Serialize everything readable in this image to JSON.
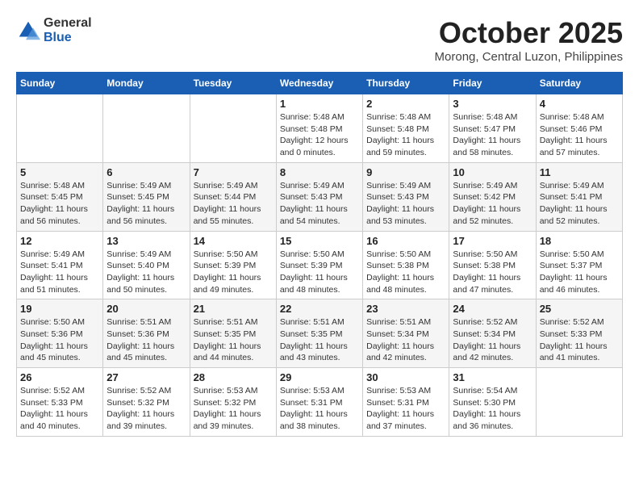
{
  "header": {
    "logo_general": "General",
    "logo_blue": "Blue",
    "month_title": "October 2025",
    "location": "Morong, Central Luzon, Philippines"
  },
  "days_of_week": [
    "Sunday",
    "Monday",
    "Tuesday",
    "Wednesday",
    "Thursday",
    "Friday",
    "Saturday"
  ],
  "weeks": [
    [
      {
        "day": "",
        "info": ""
      },
      {
        "day": "",
        "info": ""
      },
      {
        "day": "",
        "info": ""
      },
      {
        "day": "1",
        "info": "Sunrise: 5:48 AM\nSunset: 5:48 PM\nDaylight: 12 hours and 0 minutes."
      },
      {
        "day": "2",
        "info": "Sunrise: 5:48 AM\nSunset: 5:48 PM\nDaylight: 11 hours and 59 minutes."
      },
      {
        "day": "3",
        "info": "Sunrise: 5:48 AM\nSunset: 5:47 PM\nDaylight: 11 hours and 58 minutes."
      },
      {
        "day": "4",
        "info": "Sunrise: 5:48 AM\nSunset: 5:46 PM\nDaylight: 11 hours and 57 minutes."
      }
    ],
    [
      {
        "day": "5",
        "info": "Sunrise: 5:48 AM\nSunset: 5:45 PM\nDaylight: 11 hours and 56 minutes."
      },
      {
        "day": "6",
        "info": "Sunrise: 5:49 AM\nSunset: 5:45 PM\nDaylight: 11 hours and 56 minutes."
      },
      {
        "day": "7",
        "info": "Sunrise: 5:49 AM\nSunset: 5:44 PM\nDaylight: 11 hours and 55 minutes."
      },
      {
        "day": "8",
        "info": "Sunrise: 5:49 AM\nSunset: 5:43 PM\nDaylight: 11 hours and 54 minutes."
      },
      {
        "day": "9",
        "info": "Sunrise: 5:49 AM\nSunset: 5:43 PM\nDaylight: 11 hours and 53 minutes."
      },
      {
        "day": "10",
        "info": "Sunrise: 5:49 AM\nSunset: 5:42 PM\nDaylight: 11 hours and 52 minutes."
      },
      {
        "day": "11",
        "info": "Sunrise: 5:49 AM\nSunset: 5:41 PM\nDaylight: 11 hours and 52 minutes."
      }
    ],
    [
      {
        "day": "12",
        "info": "Sunrise: 5:49 AM\nSunset: 5:41 PM\nDaylight: 11 hours and 51 minutes."
      },
      {
        "day": "13",
        "info": "Sunrise: 5:49 AM\nSunset: 5:40 PM\nDaylight: 11 hours and 50 minutes."
      },
      {
        "day": "14",
        "info": "Sunrise: 5:50 AM\nSunset: 5:39 PM\nDaylight: 11 hours and 49 minutes."
      },
      {
        "day": "15",
        "info": "Sunrise: 5:50 AM\nSunset: 5:39 PM\nDaylight: 11 hours and 48 minutes."
      },
      {
        "day": "16",
        "info": "Sunrise: 5:50 AM\nSunset: 5:38 PM\nDaylight: 11 hours and 48 minutes."
      },
      {
        "day": "17",
        "info": "Sunrise: 5:50 AM\nSunset: 5:38 PM\nDaylight: 11 hours and 47 minutes."
      },
      {
        "day": "18",
        "info": "Sunrise: 5:50 AM\nSunset: 5:37 PM\nDaylight: 11 hours and 46 minutes."
      }
    ],
    [
      {
        "day": "19",
        "info": "Sunrise: 5:50 AM\nSunset: 5:36 PM\nDaylight: 11 hours and 45 minutes."
      },
      {
        "day": "20",
        "info": "Sunrise: 5:51 AM\nSunset: 5:36 PM\nDaylight: 11 hours and 45 minutes."
      },
      {
        "day": "21",
        "info": "Sunrise: 5:51 AM\nSunset: 5:35 PM\nDaylight: 11 hours and 44 minutes."
      },
      {
        "day": "22",
        "info": "Sunrise: 5:51 AM\nSunset: 5:35 PM\nDaylight: 11 hours and 43 minutes."
      },
      {
        "day": "23",
        "info": "Sunrise: 5:51 AM\nSunset: 5:34 PM\nDaylight: 11 hours and 42 minutes."
      },
      {
        "day": "24",
        "info": "Sunrise: 5:52 AM\nSunset: 5:34 PM\nDaylight: 11 hours and 42 minutes."
      },
      {
        "day": "25",
        "info": "Sunrise: 5:52 AM\nSunset: 5:33 PM\nDaylight: 11 hours and 41 minutes."
      }
    ],
    [
      {
        "day": "26",
        "info": "Sunrise: 5:52 AM\nSunset: 5:33 PM\nDaylight: 11 hours and 40 minutes."
      },
      {
        "day": "27",
        "info": "Sunrise: 5:52 AM\nSunset: 5:32 PM\nDaylight: 11 hours and 39 minutes."
      },
      {
        "day": "28",
        "info": "Sunrise: 5:53 AM\nSunset: 5:32 PM\nDaylight: 11 hours and 39 minutes."
      },
      {
        "day": "29",
        "info": "Sunrise: 5:53 AM\nSunset: 5:31 PM\nDaylight: 11 hours and 38 minutes."
      },
      {
        "day": "30",
        "info": "Sunrise: 5:53 AM\nSunset: 5:31 PM\nDaylight: 11 hours and 37 minutes."
      },
      {
        "day": "31",
        "info": "Sunrise: 5:54 AM\nSunset: 5:30 PM\nDaylight: 11 hours and 36 minutes."
      },
      {
        "day": "",
        "info": ""
      }
    ]
  ]
}
